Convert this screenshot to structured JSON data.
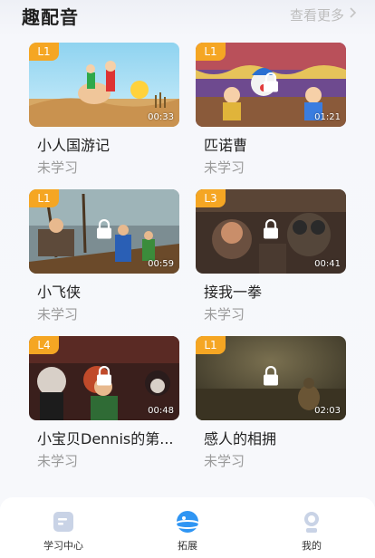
{
  "header": {
    "title": "趣配音",
    "more_label": "查看更多"
  },
  "cards": [
    {
      "title": "小人国游记",
      "status": "未学习",
      "level": "L1",
      "duration": "00:33",
      "locked": false
    },
    {
      "title": "匹诺曹",
      "status": "未学习",
      "level": "L1",
      "duration": "01:21",
      "locked": true
    },
    {
      "title": "小飞侠",
      "status": "未学习",
      "level": "L1",
      "duration": "00:59",
      "locked": true
    },
    {
      "title": "接我一拳",
      "status": "未学习",
      "level": "L3",
      "duration": "00:41",
      "locked": true
    },
    {
      "title": "小宝贝Dennis的第...",
      "status": "未学习",
      "level": "L4",
      "duration": "00:48",
      "locked": true
    },
    {
      "title": "感人的相拥",
      "status": "未学习",
      "level": "L1",
      "duration": "02:03",
      "locked": true
    }
  ],
  "tabbar": {
    "items": [
      {
        "label": "学习中心",
        "icon": "study-center-icon"
      },
      {
        "label": "拓展",
        "icon": "planet-icon"
      },
      {
        "label": "我的",
        "icon": "profile-icon"
      }
    ],
    "active": "拓展"
  },
  "colors": {
    "level_badge": "#f5a623",
    "active_tab": "#2f95f3",
    "inactive_icon": "#c9d3e6"
  }
}
